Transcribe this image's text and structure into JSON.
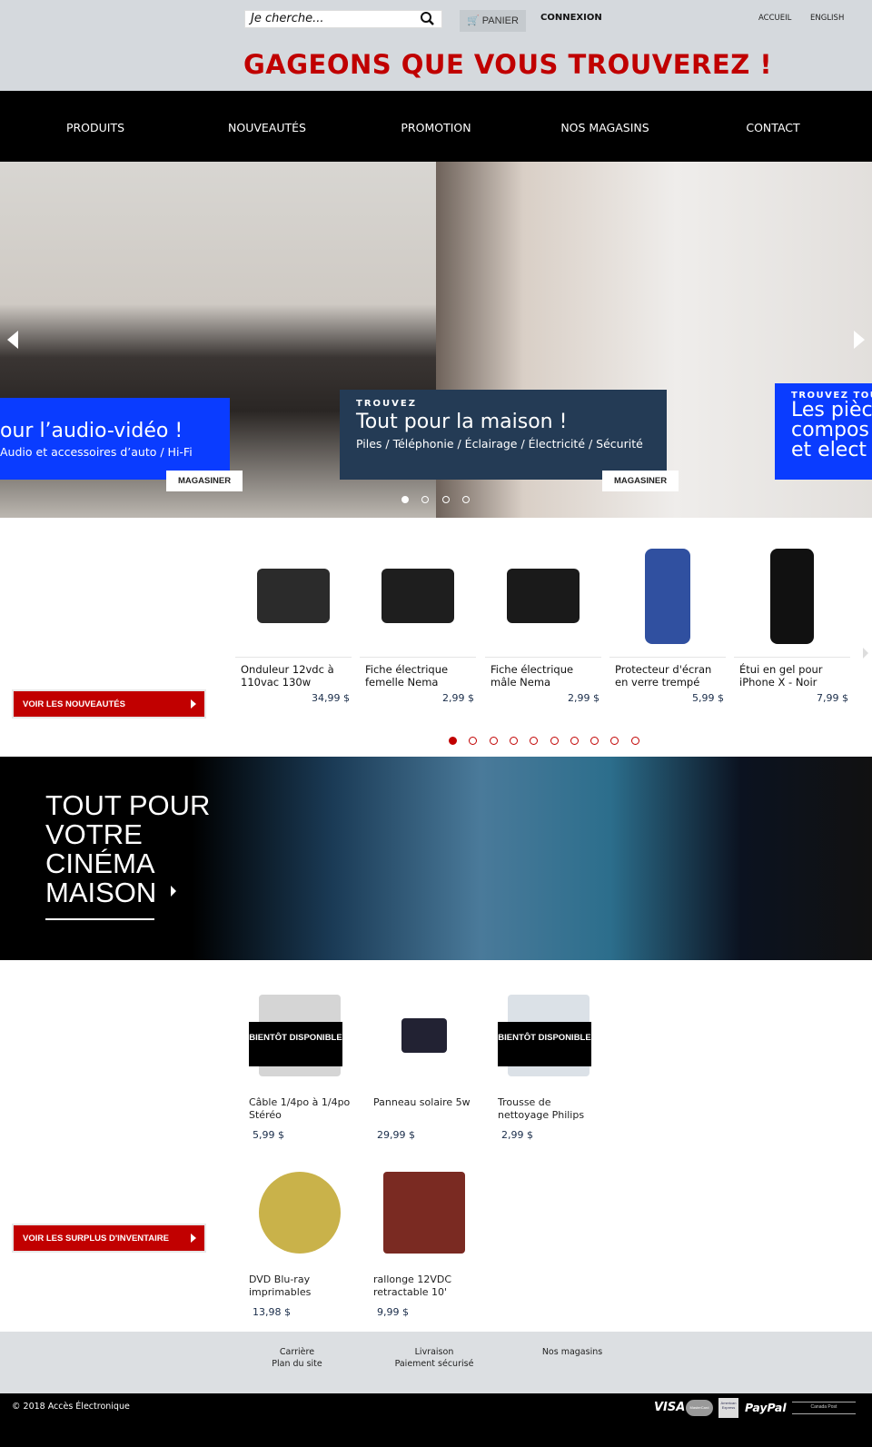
{
  "header": {
    "search_placeholder": "Je cherche...",
    "cart_label": "PANIER",
    "login_label": "CONNEXION",
    "top_links": [
      "ACCUEIL",
      "ENGLISH"
    ],
    "tagline": "GAGEONS QUE VOUS TROUVEREZ !"
  },
  "nav": [
    "PRODUITS",
    "NOUVEAUTÉS",
    "PROMOTION",
    "NOS MAGASINS",
    "CONTACT"
  ],
  "hero": {
    "slides": [
      {
        "title": "our l’audio-vidéo !",
        "subtitle": "Audio et accessoires d’auto / Hi-Fi",
        "button": "MAGASINER"
      },
      {
        "kicker": "TROUVEZ",
        "title": "Tout pour la maison !",
        "subtitle": "Piles / Téléphonie / Éclairage / Électricité / Sécurité",
        "button": "MAGASINER"
      },
      {
        "kicker": "TROUVEZ TOU",
        "title": "Les pièc compos et elect"
      }
    ],
    "active_dot": 0,
    "dot_count": 4
  },
  "new_products": {
    "button": "VOIR LES NOUVEAUTÉS",
    "active_dot": 0,
    "dot_count": 10,
    "items": [
      {
        "name": "Onduleur 12vdc à 110vac 130w",
        "price": "34,99 $"
      },
      {
        "name": "Fiche électrique femelle Nema",
        "price": "2,99 $"
      },
      {
        "name": "Fiche électrique mâle Nema",
        "price": "2,99 $"
      },
      {
        "name": "Protecteur d'écran en verre trempé",
        "price": "5,99 $"
      },
      {
        "name": "Étui en gel pour iPhone X - Noir",
        "price": "7,99 $"
      }
    ]
  },
  "cinema": {
    "title": "TOUT POUR VOTRE CINÉMA MAISON"
  },
  "surplus": {
    "button": "VOIR LES SURPLUS D'INVENTAIRE",
    "soon_label": "BIENTÔT DISPONIBLE",
    "items": [
      {
        "name": "Câble 1/4po à 1/4po Stéréo",
        "price": "5,99 $",
        "soon": true
      },
      {
        "name": "Panneau solaire 5w",
        "price": "29,99 $",
        "soon": false
      },
      {
        "name": "Trousse de nettoyage Philips",
        "price": "2,99 $",
        "soon": true
      },
      {
        "name": "DVD Blu-ray imprimables",
        "price": "13,98 $",
        "soon": false
      },
      {
        "name": "rallonge 12VDC retractable 10'",
        "price": "9,99 $",
        "soon": false
      }
    ]
  },
  "footer": {
    "links": [
      [
        "Carrière",
        "Plan du site"
      ],
      [
        "Livraison",
        "Paiement sécurisé"
      ],
      [
        "Nos magasins"
      ]
    ],
    "copyright": "© 2018 Accès Électronique",
    "payments": [
      "VISA",
      "MasterCard",
      "American Express",
      "PayPal",
      "Canada Post"
    ]
  },
  "colors": {
    "brand_red": "#c10000",
    "header_bg": "#d5d9dd",
    "caption_blue": "#0a3cff",
    "caption_navy": "#243b55"
  }
}
